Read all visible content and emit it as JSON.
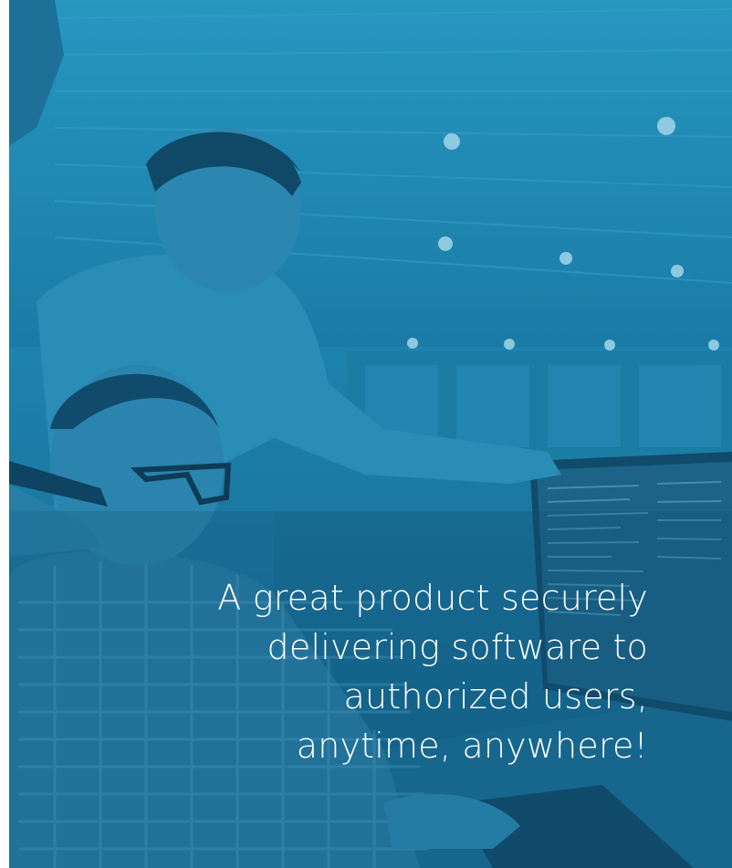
{
  "hero": {
    "tagline_lines": [
      "A great product securely",
      "delivering software to",
      "authorized users,",
      "anytime, anywhere!"
    ]
  },
  "colors": {
    "overlay_blue": "#1f86b0",
    "text": "#ffffff"
  }
}
